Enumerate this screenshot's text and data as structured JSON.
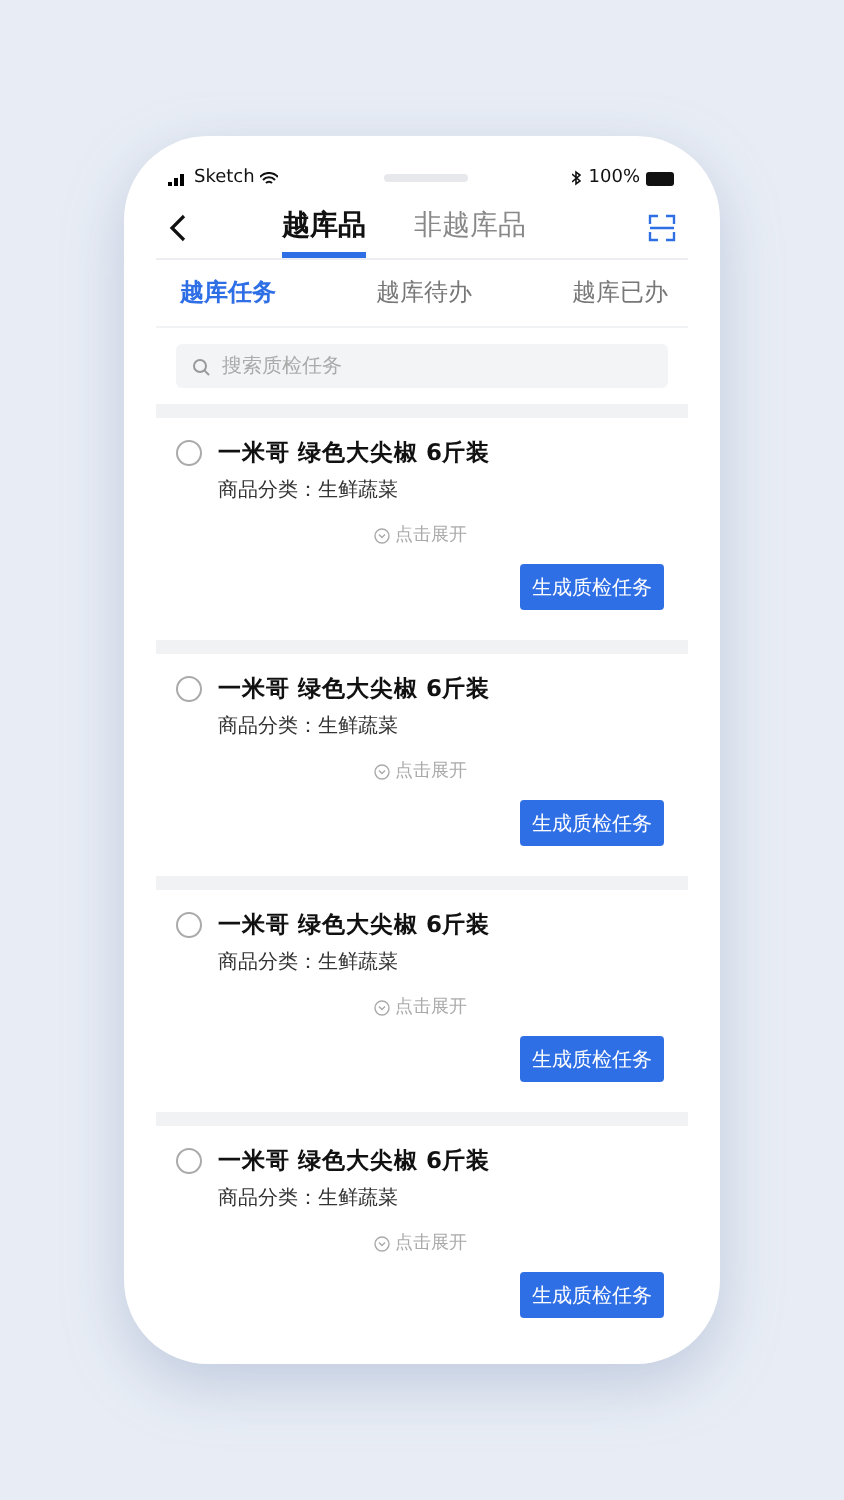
{
  "status_bar": {
    "carrier": "Sketch",
    "battery": "100%"
  },
  "nav_tabs": [
    {
      "label": "越库品",
      "selected": true
    },
    {
      "label": "非越库品",
      "selected": false
    }
  ],
  "sub_tabs": [
    {
      "label": "越库任务",
      "selected": true
    },
    {
      "label": "越库待办",
      "selected": false
    },
    {
      "label": "越库已办",
      "selected": false
    }
  ],
  "search": {
    "placeholder": "搜索质检任务"
  },
  "items": [
    {
      "title": "一米哥 绿色大尖椒 6斤装",
      "category": "商品分类：生鲜蔬菜",
      "expand": "点击展开",
      "button": "生成质检任务",
      "checked": false
    },
    {
      "title": "一米哥 绿色大尖椒 6斤装",
      "category": "商品分类：生鲜蔬菜",
      "expand": "点击展开",
      "button": "生成质检任务",
      "checked": false
    },
    {
      "title": "一米哥 绿色大尖椒 6斤装",
      "category": "商品分类：生鲜蔬菜",
      "expand": "点击展开",
      "button": "生成质检任务",
      "checked": false
    },
    {
      "title": "一米哥 绿色大尖椒 6斤装",
      "category": "商品分类：生鲜蔬菜",
      "expand": "点击展开",
      "button": "生成质检任务",
      "checked": false
    }
  ]
}
